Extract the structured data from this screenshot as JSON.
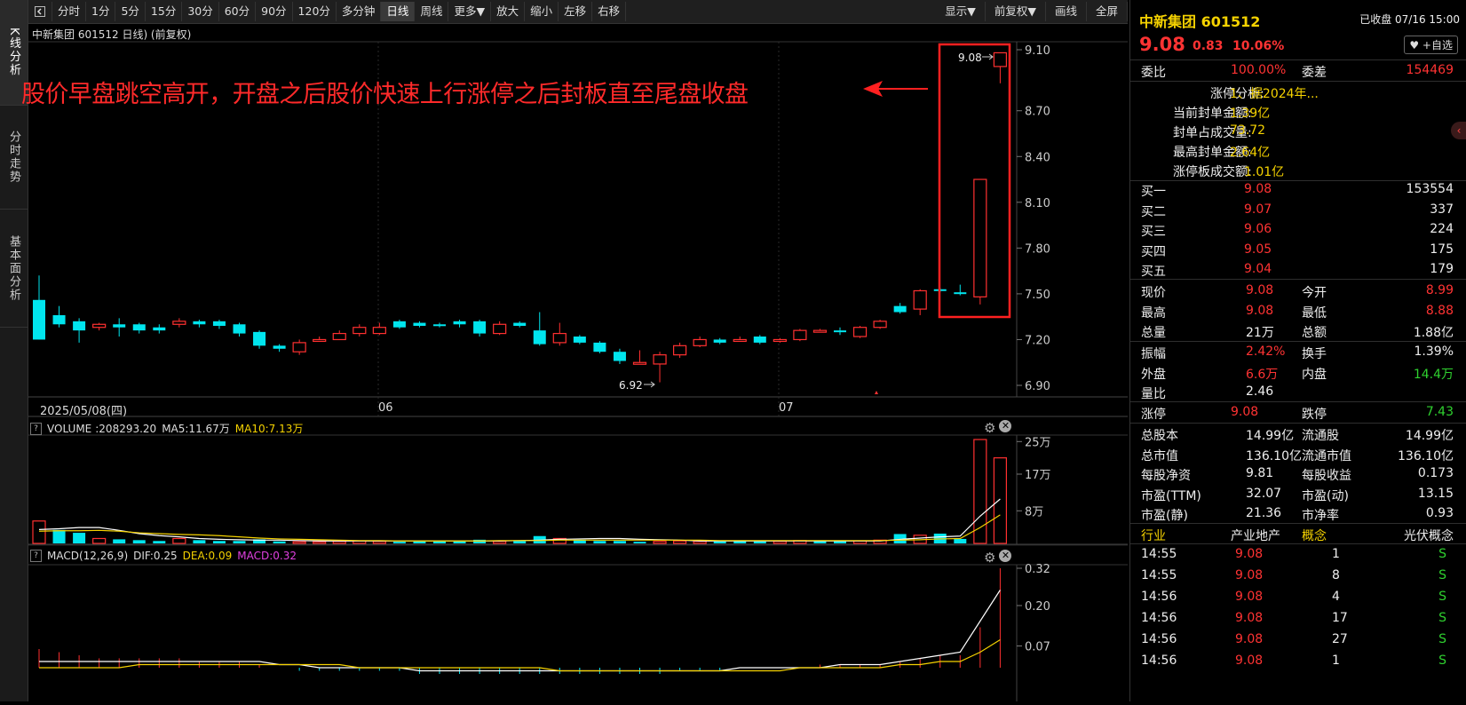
{
  "rail": {
    "tabs": [
      "K线分析",
      "分时走势",
      "基本面分析"
    ]
  },
  "toolbar": {
    "items": [
      "分时",
      "1分",
      "5分",
      "15分",
      "30分",
      "60分",
      "90分",
      "120分",
      "多分钟",
      "日线",
      "周线",
      "更多▼",
      "放大",
      "缩小",
      "左移",
      "右移"
    ],
    "right_items": [
      "显示▼",
      "前复权▼",
      "画线",
      "全屏"
    ]
  },
  "chart": {
    "header": "中新集团 601512 日线) (前复权)",
    "annotation": "股价早盘跳空高开，开盘之后股价快速上行涨停之后封板直至尾盘收盘",
    "price_axis": [
      "9.10",
      "8.70",
      "8.40",
      "8.10",
      "7.80",
      "7.50",
      "7.20",
      "6.90"
    ],
    "high_label": "9.08",
    "low_label": "6.92",
    "date_labels": [
      "2025/05/08(四)",
      "06",
      "07"
    ]
  },
  "volume": {
    "title_prefix": "VOLUME",
    "value": ":208293.20",
    "ma5": "MA5:11.67万",
    "ma10": "MA10:7.13万",
    "axis": [
      "25万",
      "17万",
      "8万"
    ]
  },
  "macd": {
    "title_prefix": "MACD(12,26,9)",
    "dif": "DIF:0.25",
    "dea": "DEA:0.09",
    "macd": "MACD:0.32",
    "axis": [
      "0.32",
      "0.20",
      "0.07"
    ]
  },
  "chart_data": {
    "type": "candlestick",
    "candles": [
      [
        7.46,
        7.2,
        7.62,
        7.2
      ],
      [
        7.36,
        7.3,
        7.42,
        7.28
      ],
      [
        7.32,
        7.26,
        7.34,
        7.18
      ],
      [
        7.28,
        7.3,
        7.31,
        7.26
      ],
      [
        7.3,
        7.28,
        7.34,
        7.22
      ],
      [
        7.3,
        7.26,
        7.31,
        7.24
      ],
      [
        7.28,
        7.26,
        7.3,
        7.24
      ],
      [
        7.3,
        7.32,
        7.34,
        7.28
      ],
      [
        7.32,
        7.3,
        7.33,
        7.28
      ],
      [
        7.32,
        7.29,
        7.33,
        7.27
      ],
      [
        7.3,
        7.24,
        7.31,
        7.22
      ],
      [
        7.25,
        7.16,
        7.26,
        7.14
      ],
      [
        7.16,
        7.14,
        7.17,
        7.12
      ],
      [
        7.12,
        7.18,
        7.2,
        7.1
      ],
      [
        7.2,
        7.2,
        7.22,
        7.19
      ],
      [
        7.2,
        7.24,
        7.26,
        7.2
      ],
      [
        7.24,
        7.28,
        7.3,
        7.22
      ],
      [
        7.24,
        7.28,
        7.31,
        7.23
      ],
      [
        7.32,
        7.28,
        7.33,
        7.27
      ],
      [
        7.31,
        7.29,
        7.32,
        7.28
      ],
      [
        7.3,
        7.29,
        7.31,
        7.28
      ],
      [
        7.32,
        7.3,
        7.33,
        7.28
      ],
      [
        7.32,
        7.24,
        7.33,
        7.22
      ],
      [
        7.24,
        7.3,
        7.32,
        7.23
      ],
      [
        7.31,
        7.29,
        7.32,
        7.28
      ],
      [
        7.26,
        7.17,
        7.38,
        7.16
      ],
      [
        7.18,
        7.24,
        7.31,
        7.16
      ],
      [
        7.22,
        7.18,
        7.23,
        7.17
      ],
      [
        7.18,
        7.12,
        7.19,
        7.11
      ],
      [
        7.12,
        7.06,
        7.14,
        7.04
      ],
      [
        7.05,
        7.05,
        7.13,
        7.04
      ],
      [
        7.04,
        7.1,
        7.12,
        6.92
      ],
      [
        7.1,
        7.16,
        7.18,
        7.08
      ],
      [
        7.16,
        7.2,
        7.22,
        7.15
      ],
      [
        7.2,
        7.18,
        7.21,
        7.17
      ],
      [
        7.2,
        7.2,
        7.22,
        7.19
      ],
      [
        7.22,
        7.18,
        7.23,
        7.17
      ],
      [
        7.19,
        7.2,
        7.21,
        7.18
      ],
      [
        7.2,
        7.26,
        7.27,
        7.19
      ],
      [
        7.26,
        7.26,
        7.27,
        7.25
      ],
      [
        7.26,
        7.25,
        7.28,
        7.23
      ],
      [
        7.22,
        7.28,
        7.29,
        7.21
      ],
      [
        7.28,
        7.32,
        7.33,
        7.27
      ],
      [
        7.42,
        7.38,
        7.44,
        7.37
      ],
      [
        7.4,
        7.52,
        7.53,
        7.36
      ],
      [
        7.53,
        7.52,
        7.54,
        7.51
      ],
      [
        7.51,
        7.5,
        7.56,
        7.49
      ],
      [
        7.48,
        8.25,
        8.25,
        7.43
      ],
      [
        8.99,
        9.08,
        9.08,
        8.88
      ]
    ],
    "volumes": [
      [
        5.5,
        1
      ],
      [
        3.3,
        0
      ],
      [
        2.6,
        0
      ],
      [
        1.2,
        1
      ],
      [
        1.0,
        0
      ],
      [
        0.8,
        0
      ],
      [
        0.6,
        0
      ],
      [
        1.2,
        1
      ],
      [
        0.8,
        0
      ],
      [
        0.6,
        0
      ],
      [
        0.6,
        0
      ],
      [
        1.0,
        0
      ],
      [
        0.5,
        0
      ],
      [
        0.4,
        1
      ],
      [
        0.4,
        1
      ],
      [
        0.5,
        1
      ],
      [
        0.6,
        1
      ],
      [
        0.5,
        1
      ],
      [
        0.4,
        0
      ],
      [
        0.5,
        0
      ],
      [
        0.5,
        0
      ],
      [
        0.5,
        0
      ],
      [
        0.9,
        0
      ],
      [
        0.5,
        1
      ],
      [
        0.6,
        0
      ],
      [
        1.8,
        0
      ],
      [
        1.2,
        1
      ],
      [
        0.9,
        0
      ],
      [
        0.6,
        0
      ],
      [
        0.6,
        0
      ],
      [
        0.4,
        0
      ],
      [
        0.5,
        1
      ],
      [
        0.6,
        1
      ],
      [
        0.5,
        1
      ],
      [
        0.5,
        0
      ],
      [
        0.6,
        0
      ],
      [
        0.5,
        0
      ],
      [
        0.5,
        1
      ],
      [
        0.7,
        1
      ],
      [
        0.6,
        0
      ],
      [
        0.6,
        0
      ],
      [
        0.6,
        1
      ],
      [
        0.8,
        1
      ],
      [
        2.3,
        0
      ],
      [
        2.0,
        1
      ],
      [
        2.4,
        0
      ],
      [
        1.1,
        0
      ],
      [
        25.5,
        1
      ],
      [
        21.0,
        1
      ]
    ],
    "ma5": [
      3.4,
      3.6,
      3.9,
      3.9,
      3.2,
      2.4,
      1.9,
      1.6,
      1.2,
      1.0,
      0.9,
      0.8,
      0.8,
      0.7,
      0.6,
      0.6,
      0.6,
      0.6,
      0.6,
      0.6,
      0.6,
      0.6,
      0.6,
      0.6,
      0.7,
      0.8,
      1.0,
      1.1,
      1.2,
      1.2,
      1.0,
      0.9,
      0.8,
      0.6,
      0.6,
      0.6,
      0.6,
      0.6,
      0.6,
      0.6,
      0.6,
      0.6,
      0.6,
      1.0,
      1.3,
      1.6,
      1.8,
      6.7,
      10.9
    ],
    "ma10": [
      3.0,
      3.1,
      3.1,
      3.2,
      3.0,
      2.6,
      2.4,
      2.2,
      2.1,
      1.9,
      1.6,
      1.3,
      1.1,
      1.0,
      0.9,
      0.8,
      0.7,
      0.7,
      0.6,
      0.6,
      0.6,
      0.6,
      0.6,
      0.7,
      0.7,
      0.7,
      0.8,
      0.8,
      0.8,
      0.8,
      0.8,
      0.8,
      0.8,
      0.8,
      0.7,
      0.7,
      0.7,
      0.7,
      0.7,
      0.7,
      0.7,
      0.7,
      0.7,
      0.8,
      0.9,
      1.1,
      1.2,
      3.9,
      7.0
    ],
    "macd_bars": [
      0.06,
      0.05,
      0.04,
      0.03,
      0.03,
      0.03,
      0.03,
      0.03,
      0.02,
      0.02,
      0.02,
      0.01,
      0.0,
      -0.01,
      -0.01,
      -0.01,
      -0.01,
      -0.01,
      -0.01,
      -0.02,
      -0.02,
      -0.02,
      -0.02,
      -0.02,
      -0.02,
      -0.02,
      -0.02,
      -0.02,
      -0.02,
      -0.02,
      -0.02,
      -0.02,
      -0.01,
      -0.01,
      -0.01,
      0.0,
      0.0,
      0.0,
      0.0,
      0.01,
      0.01,
      0.01,
      0.01,
      0.02,
      0.03,
      0.04,
      0.04,
      0.13,
      0.32
    ],
    "dif": [
      0.02,
      0.02,
      0.02,
      0.02,
      0.02,
      0.02,
      0.02,
      0.02,
      0.02,
      0.02,
      0.02,
      0.02,
      0.01,
      0.01,
      0.0,
      0.0,
      0.0,
      0.0,
      0.0,
      -0.01,
      -0.01,
      -0.01,
      -0.01,
      -0.01,
      -0.01,
      -0.01,
      -0.01,
      -0.01,
      -0.01,
      -0.01,
      -0.01,
      -0.01,
      -0.01,
      -0.01,
      -0.01,
      0.0,
      0.0,
      0.0,
      0.0,
      0.0,
      0.01,
      0.01,
      0.01,
      0.02,
      0.03,
      0.04,
      0.05,
      0.15,
      0.25
    ],
    "dea": [
      0.0,
      0.0,
      0.0,
      0.0,
      0.0,
      0.01,
      0.01,
      0.01,
      0.01,
      0.01,
      0.01,
      0.01,
      0.01,
      0.01,
      0.01,
      0.01,
      0.0,
      0.0,
      0.0,
      0.0,
      0.0,
      0.0,
      0.0,
      0.0,
      0.0,
      0.0,
      -0.01,
      -0.01,
      -0.01,
      -0.01,
      -0.01,
      -0.01,
      -0.01,
      -0.01,
      -0.01,
      -0.01,
      -0.01,
      -0.01,
      0.0,
      0.0,
      0.0,
      0.0,
      0.0,
      0.01,
      0.01,
      0.02,
      0.02,
      0.05,
      0.09
    ]
  },
  "quote": {
    "name": "中新集团 601512",
    "status": "已收盘 07/16 15:00",
    "price": "9.08",
    "change": "0.83",
    "pct": "10.06%",
    "watch_btn": "♥ +自选",
    "weibi_label": "委比",
    "weibi": "100.00%",
    "weicha_label": "委差",
    "weicha": "154469",
    "limit_info": [
      {
        "label": "涨停分析:",
        "value": "1、据2024年..."
      },
      {
        "label": "当前封单金额:",
        "value": "1.39亿"
      },
      {
        "label": "封单占成交量:",
        "value": "73.72"
      },
      {
        "label": "最高封单金额:",
        "value": "2.64亿"
      },
      {
        "label": "涨停板成交额:",
        "value": "1.01亿"
      }
    ],
    "bids": [
      {
        "label": "买一",
        "price": "9.08",
        "vol": "153554"
      },
      {
        "label": "买二",
        "price": "9.07",
        "vol": "337"
      },
      {
        "label": "买三",
        "price": "9.06",
        "vol": "224"
      },
      {
        "label": "买四",
        "price": "9.05",
        "vol": "175"
      },
      {
        "label": "买五",
        "price": "9.04",
        "vol": "179"
      }
    ],
    "stats": [
      [
        {
          "label": "现价",
          "value": "9.08",
          "c": "red"
        },
        {
          "label": "今开",
          "value": "8.99",
          "c": "red"
        }
      ],
      [
        {
          "label": "最高",
          "value": "9.08",
          "c": "red"
        },
        {
          "label": "最低",
          "value": "8.88",
          "c": "red"
        }
      ],
      [
        {
          "label": "总量",
          "value": "21万",
          "c": "white"
        },
        {
          "label": "总额",
          "value": "1.88亿",
          "c": "white"
        }
      ]
    ],
    "stats2": [
      [
        {
          "label": "振幅",
          "value": "2.42%",
          "c": "red"
        },
        {
          "label": "换手",
          "value": "1.39%",
          "c": "white"
        }
      ],
      [
        {
          "label": "外盘",
          "value": "6.6万",
          "c": "red"
        },
        {
          "label": "内盘",
          "value": "14.4万",
          "c": "green"
        }
      ],
      [
        {
          "label": "量比",
          "value": "2.46",
          "c": "white"
        },
        {
          "label": "",
          "value": "",
          "c": "white"
        }
      ]
    ],
    "limits": [
      {
        "label": "涨停",
        "value": "9.08",
        "c": "red"
      },
      {
        "label": "跌停",
        "value": "7.43",
        "c": "green"
      }
    ],
    "fundamentals": [
      [
        {
          "label": "总股本",
          "value": "14.99亿"
        },
        {
          "label": "流通股",
          "value": "14.99亿"
        }
      ],
      [
        {
          "label": "总市值",
          "value": "136.10亿"
        },
        {
          "label": "流通市值",
          "value": "136.10亿"
        }
      ],
      [
        {
          "label": "每股净资",
          "value": "9.81"
        },
        {
          "label": "每股收益",
          "value": "0.173"
        }
      ],
      [
        {
          "label": "市盈(TTM)",
          "value": "32.07"
        },
        {
          "label": "市盈(动)",
          "value": "13.15"
        }
      ],
      [
        {
          "label": "市盈(静)",
          "value": "21.36"
        },
        {
          "label": "市净率",
          "value": "0.93"
        }
      ]
    ],
    "industry": {
      "label": "行业",
      "value": "产业地产",
      "concept_label": "概念",
      "concept_value": "光伏概念"
    },
    "ticks": [
      {
        "time": "14:55",
        "price": "9.08",
        "vol": "1",
        "side": "S"
      },
      {
        "time": "14:55",
        "price": "9.08",
        "vol": "8",
        "side": "S"
      },
      {
        "time": "14:56",
        "price": "9.08",
        "vol": "4",
        "side": "S"
      },
      {
        "time": "14:56",
        "price": "9.08",
        "vol": "17",
        "side": "S"
      },
      {
        "time": "14:56",
        "price": "9.08",
        "vol": "27",
        "side": "S"
      },
      {
        "time": "14:56",
        "price": "9.08",
        "vol": "1",
        "side": "S"
      }
    ]
  }
}
